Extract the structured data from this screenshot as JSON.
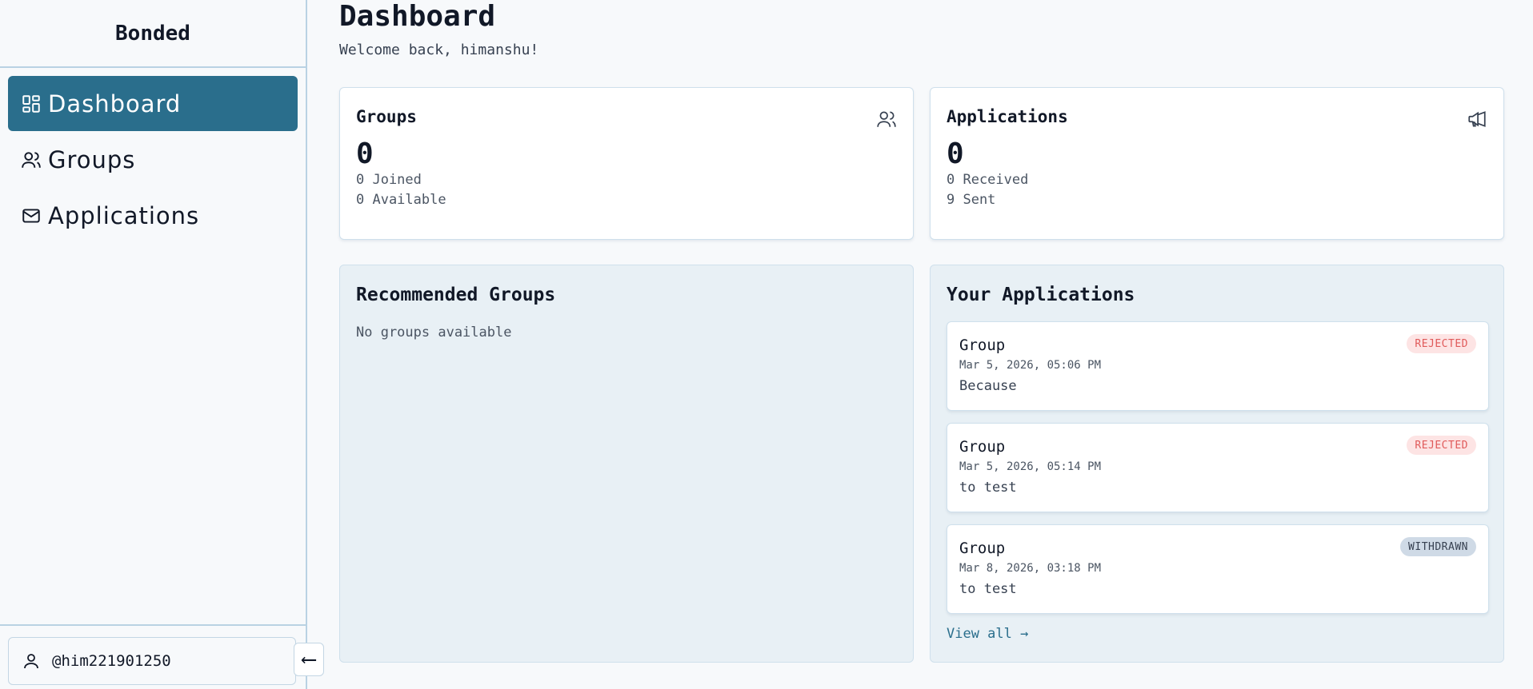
{
  "app": {
    "brand": "Bonded"
  },
  "sidebar": {
    "items": [
      {
        "label": "Dashboard",
        "icon": "dashboard-icon",
        "active": true
      },
      {
        "label": "Groups",
        "icon": "users-icon",
        "active": false
      },
      {
        "label": "Applications",
        "icon": "mail-icon",
        "active": false
      }
    ],
    "user": "@him221901250",
    "collapse_glyph": "⟵"
  },
  "header": {
    "title": "Dashboard",
    "welcome": "Welcome back, himanshu!"
  },
  "stats": {
    "groups": {
      "title": "Groups",
      "value": "0",
      "line1": "0 Joined",
      "line2": "0 Available",
      "icon": "users-icon"
    },
    "applications": {
      "title": "Applications",
      "value": "0",
      "line1": "0 Received",
      "line2": "9 Sent",
      "icon": "megaphone-icon"
    }
  },
  "recommended": {
    "title": "Recommended Groups",
    "empty": "No groups available"
  },
  "your_applications": {
    "title": "Your Applications",
    "items": [
      {
        "group": "Group",
        "date": "Mar 5, 2026, 05:06 PM",
        "message": "Because",
        "status": "REJECTED"
      },
      {
        "group": "Group",
        "date": "Mar 5, 2026, 05:14 PM",
        "message": "to test",
        "status": "REJECTED"
      },
      {
        "group": "Group",
        "date": "Mar 8, 2026, 03:18 PM",
        "message": "to test",
        "status": "WITHDRAWN"
      }
    ],
    "view_all": "View all →"
  },
  "colors": {
    "accent": "#2a6e8c",
    "border": "#b9d2e3",
    "rejected_bg": "#fde4e4",
    "rejected_text": "#e05a5a",
    "withdrawn_bg": "#cfdae6"
  }
}
